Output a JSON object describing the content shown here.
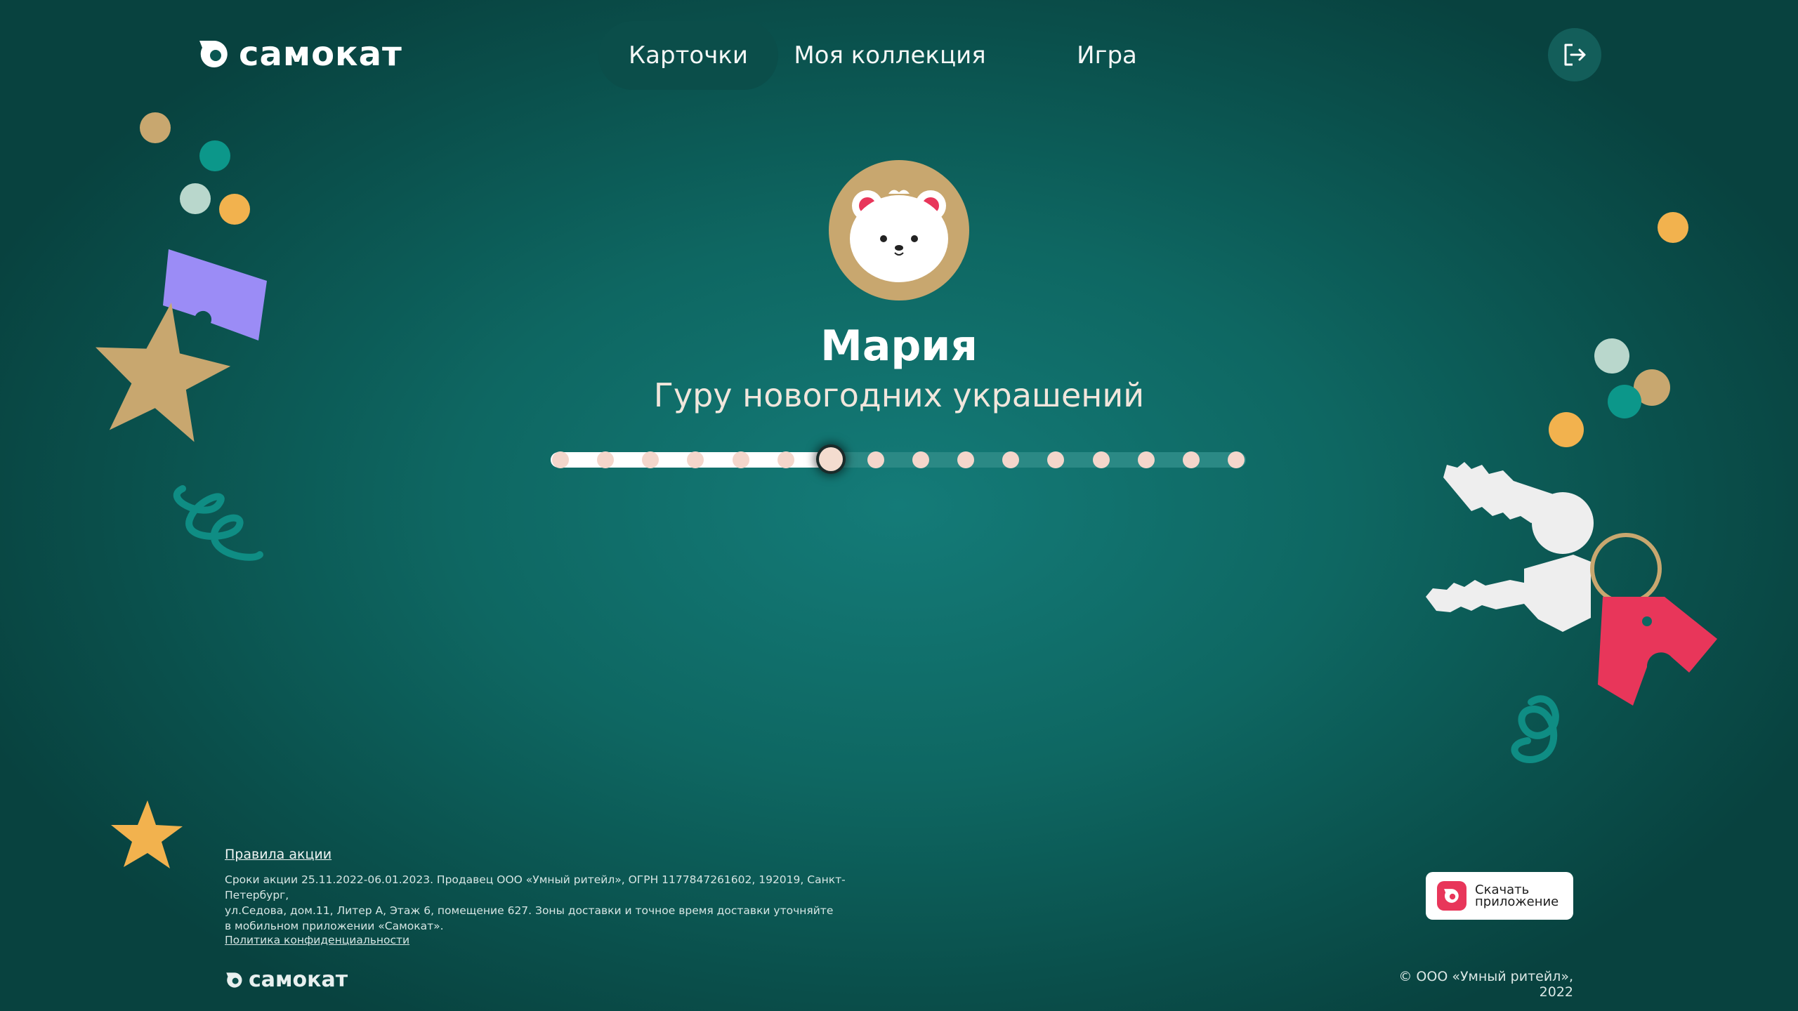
{
  "header": {
    "brand": "самокат",
    "nav": [
      {
        "label": "Карточки",
        "active": true
      },
      {
        "label": "Моя коллекция",
        "active": false
      },
      {
        "label": "Игра",
        "active": false
      }
    ],
    "exit_icon": "logout-icon"
  },
  "profile": {
    "avatar_icon": "polar-bear-avatar",
    "name": "Мария",
    "title": "Гуру новогодних украшений",
    "progress": {
      "total_steps": 16,
      "current_step": 7
    }
  },
  "footer": {
    "rules_link": "Правила акции",
    "legal_lines": [
      "Сроки акции 25.11.2022-06.01.2023. Продавец ООО «Умный ритейл», ОГРН 1177847261602, 192019, Санкт-Петербург,",
      "ул.Седова, дом.11, Литер А, Этаж 6, помещение 627. Зоны доставки и точное время доставки уточняйте",
      "в мобильном приложении «Самокат»."
    ],
    "privacy_link": "Политика конфиденциальности",
    "brand": "самокат",
    "app_button": {
      "line1": "Скачать",
      "line2": "приложение"
    },
    "copyright": "© ООО «Умный ритейл», 2022"
  },
  "colors": {
    "background": "#0e6762",
    "nav_active": "#0b4e4a",
    "accent_gold": "#c8a76f",
    "accent_pink": "#e8365a",
    "accent_purple": "#9b8cf6",
    "accent_orange": "#f2b24e"
  }
}
